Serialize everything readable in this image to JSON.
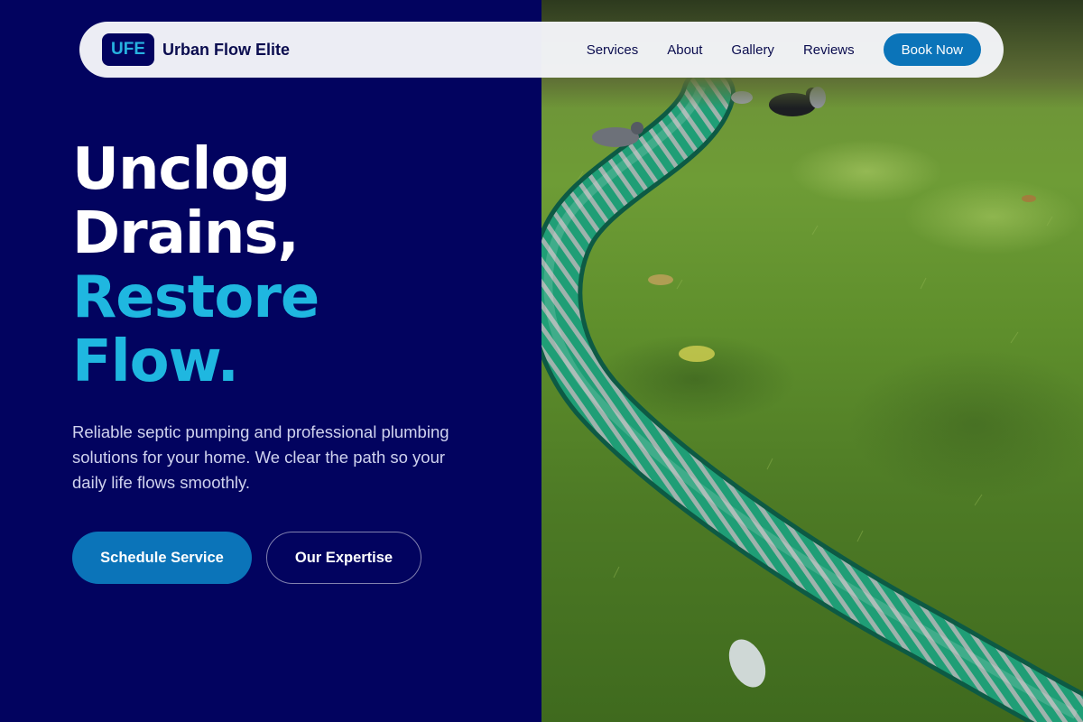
{
  "nav": {
    "logo_badge": "UFE",
    "brand_name": "Urban Flow Elite",
    "links": [
      "Services",
      "About",
      "Gallery",
      "Reviews"
    ],
    "cta": "Book Now"
  },
  "hero": {
    "title_lines": [
      "Unclog",
      "Drains,",
      "Restore",
      "Flow."
    ],
    "description": "Reliable septic pumping and professional plumbing solutions for your home. We clear the path so your daily life flows smoothly.",
    "primary_button": "Schedule Service",
    "secondary_button": "Our Expertise"
  },
  "colors": {
    "navy_background": "#02035f",
    "accent_cyan": "#1fb7e0",
    "button_blue": "#0b74b9"
  }
}
